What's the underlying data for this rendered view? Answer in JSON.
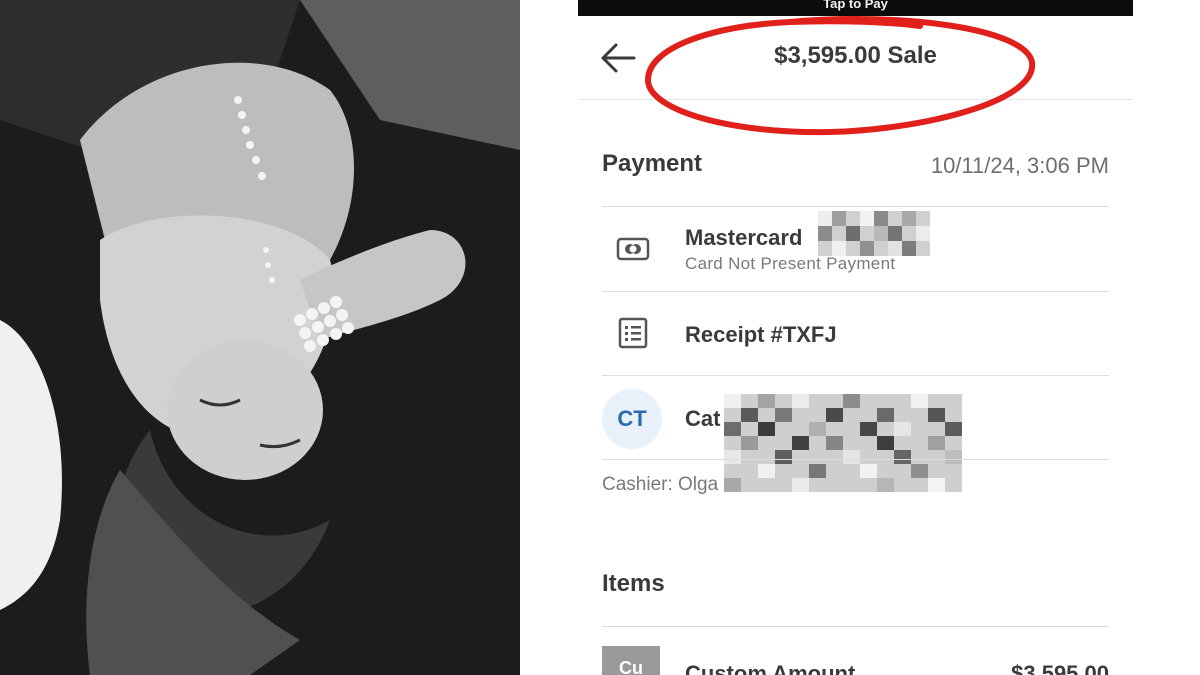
{
  "status_bar": {
    "label": "Tap to Pay"
  },
  "header": {
    "title": "$3,595.00 Sale"
  },
  "payment": {
    "heading": "Payment",
    "datetime": "10/11/24, 3:06 PM",
    "card": {
      "name": "Mastercard",
      "subtitle": "Card Not Present Payment",
      "icon": "card-icon"
    },
    "receipt": {
      "label": "Receipt #TXFJ",
      "icon": "receipt-list-icon"
    },
    "customer": {
      "initials": "CT",
      "name": "Cat"
    },
    "cashier": "Cashier: Olga"
  },
  "items": {
    "heading": "Items",
    "list": [
      {
        "thumb": "Cu",
        "name": "Custom Amount",
        "price": "$3,595.00"
      }
    ]
  },
  "colors": {
    "annotation": "#e0201b",
    "avatar_bg": "#e8f0fa",
    "avatar_text": "#2a6bb0"
  }
}
